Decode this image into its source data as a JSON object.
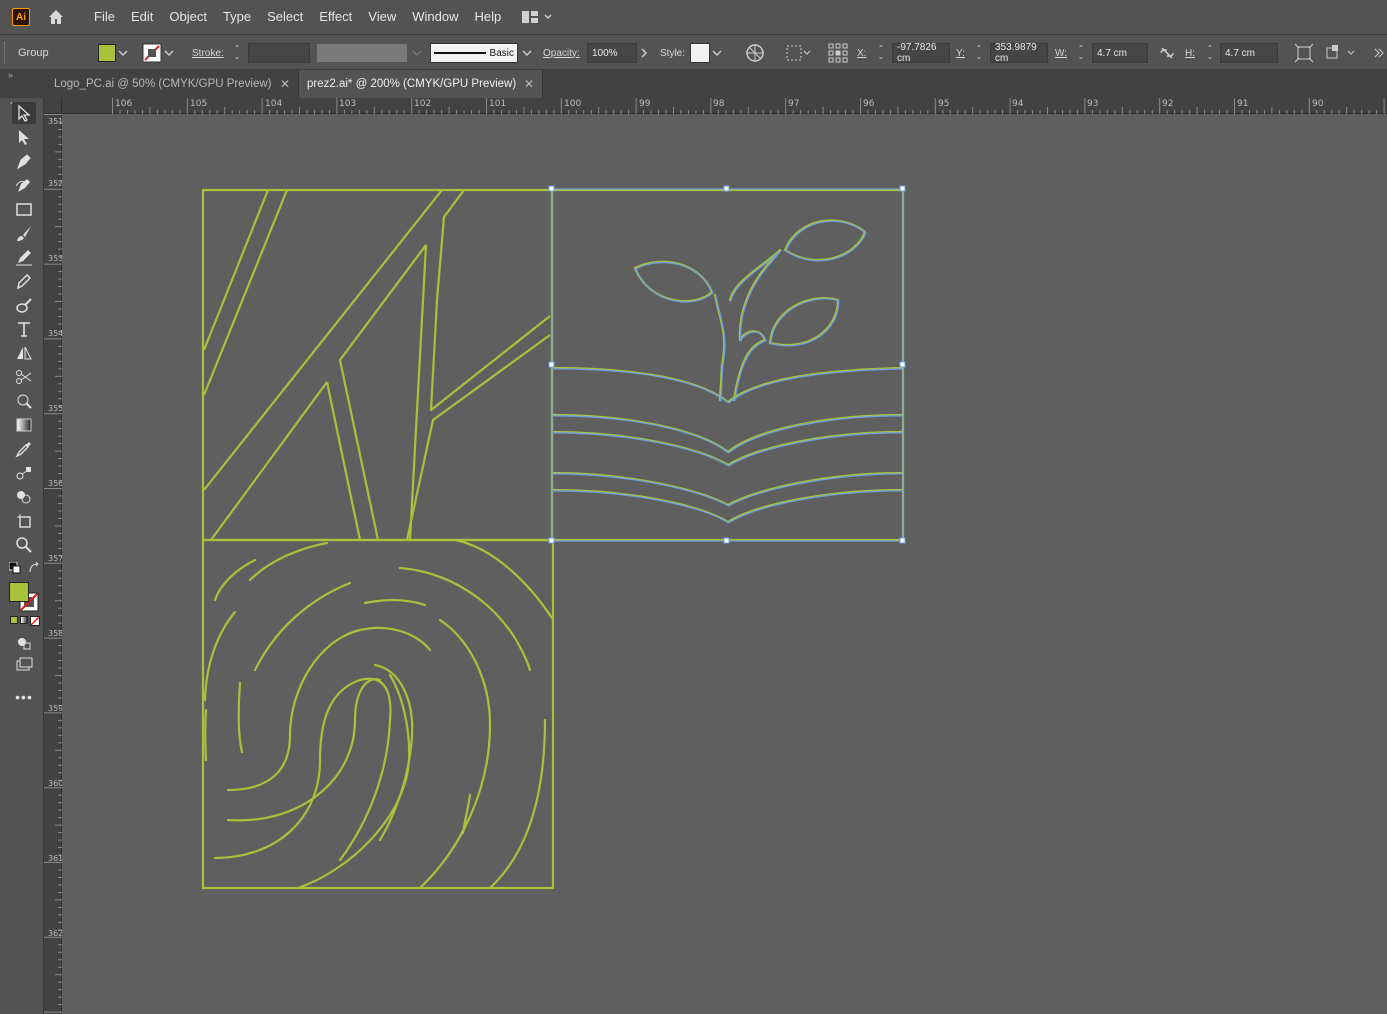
{
  "app": {
    "logo": "Ai"
  },
  "menu": [
    "File",
    "Edit",
    "Object",
    "Type",
    "Select",
    "Effect",
    "View",
    "Window",
    "Help"
  ],
  "control": {
    "selection_type": "Group",
    "fill_color": "#a8c23c",
    "stroke_label": "Stroke:",
    "brush_label": "Basic",
    "opacity_label": "Opacity:",
    "opacity_value": "100%",
    "style_label": "Style:",
    "x_label": "X:",
    "x_value": "-97.7826 cm",
    "y_label": "Y:",
    "y_value": "353.9879 cm",
    "w_label": "W:",
    "w_value": "4.7 cm",
    "h_label": "H:",
    "h_value": "4.7 cm"
  },
  "tabs": [
    {
      "label": "Logo_PC.ai @ 50% (CMYK/GPU Preview)",
      "active": false
    },
    {
      "label": "prez2.ai* @ 200% (CMYK/GPU Preview)",
      "active": true
    }
  ],
  "ruler": {
    "horizontal": [
      "106",
      "105",
      "104",
      "103",
      "102",
      "101",
      "100",
      "99",
      "98",
      "97",
      "96",
      "95",
      "94",
      "93",
      "92",
      "91",
      "90"
    ],
    "vertical": [
      "351",
      "352",
      "353",
      "354",
      "355",
      "356",
      "357",
      "358",
      "359",
      "360",
      "361",
      "362"
    ]
  },
  "colors": {
    "artwork_stroke": "#a8c23c",
    "selection": "#6f9fe0",
    "canvas_bg": "#5f5f5f"
  },
  "icons": [
    "pointer-icon",
    "direct-select-icon",
    "pen-icon",
    "curvature-icon",
    "rectangle-icon",
    "paintbrush-icon",
    "pencil-icon",
    "eraser-icon",
    "blob-brush-icon",
    "type-icon",
    "reflect-icon",
    "scissors-icon",
    "puppet-warp-icon",
    "gradient-icon",
    "eyedropper-icon",
    "blend-icon",
    "shape-builder-icon",
    "artboard-icon",
    "zoom-icon"
  ]
}
